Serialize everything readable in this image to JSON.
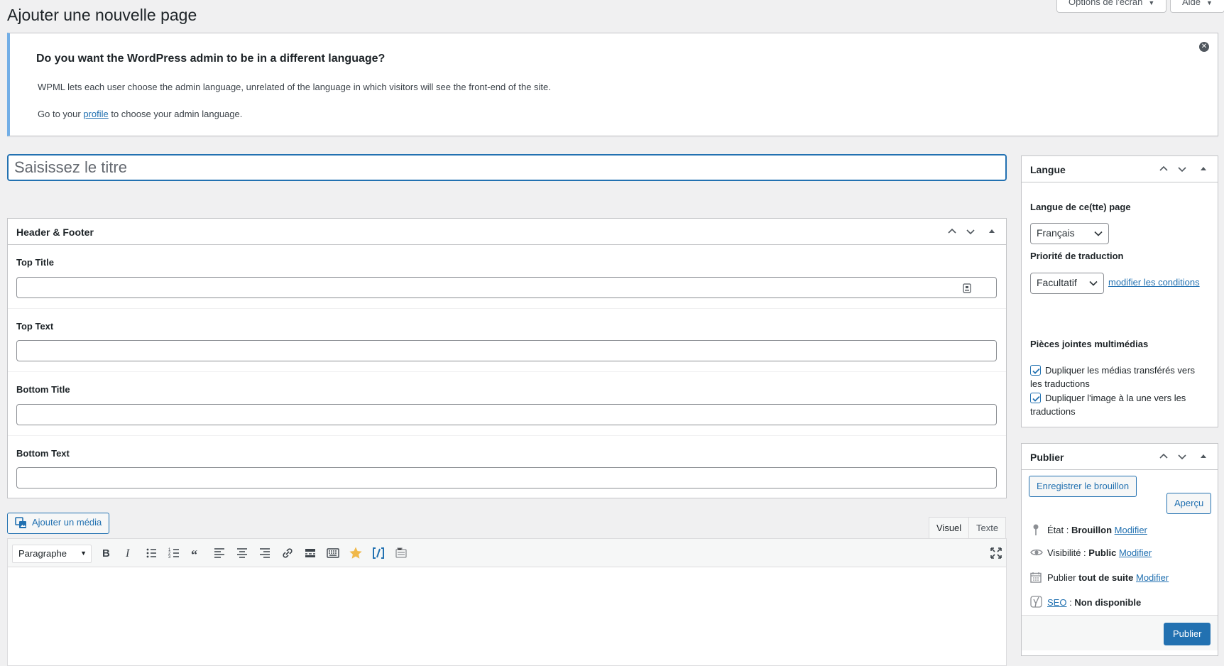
{
  "page": {
    "title": "Ajouter une nouvelle page"
  },
  "screen_options": {
    "label": "Options de l'écran"
  },
  "help": {
    "label": "Aide"
  },
  "notice": {
    "heading": "Do you want the WordPress admin to be in a different language?",
    "line1": "WPML lets each user choose the admin language, unrelated of the language in which visitors will see the front-end of the site.",
    "line2_before": "Go to your ",
    "line2_link": "profile",
    "line2_after": " to choose your admin language."
  },
  "title_input": {
    "placeholder": "Saisissez le titre",
    "value": ""
  },
  "header_footer": {
    "title": "Header & Footer",
    "fields": [
      {
        "label": "Top Title",
        "value": ""
      },
      {
        "label": "Top Text",
        "value": ""
      },
      {
        "label": "Bottom Title",
        "value": ""
      },
      {
        "label": "Bottom Text",
        "value": ""
      }
    ]
  },
  "editor": {
    "add_media": "Ajouter un média",
    "tabs": [
      "Visuel",
      "Texte"
    ],
    "active_tab": "Visuel",
    "format": "Paragraphe",
    "toolbar_icons": [
      "bold-icon",
      "italic-icon",
      "bullet-list-icon",
      "numbered-list-icon",
      "blockquote-icon",
      "align-left-icon",
      "align-center-icon",
      "align-right-icon",
      "link-icon",
      "read-more-icon",
      "toolbar-toggle-icon",
      "star-icon",
      "shortcode-icon",
      "form-icon",
      "fullscreen-icon"
    ],
    "accent_colors": {
      "star": "#f0b849",
      "shortcode": "#2271b1"
    }
  },
  "langue": {
    "title": "Langue",
    "lang_label": "Langue de ce(tte) page",
    "lang_value": "Français",
    "priority_label": "Priorité de traduction",
    "priority_value": "Facultatif",
    "priority_link": "modifier les conditions",
    "media_label": "Pièces jointes multimédias",
    "checkbox1": "Dupliquer les médias transférés vers les traductions",
    "checkbox2": "Dupliquer l'image à la une vers les traductions",
    "checkbox1_checked": true,
    "checkbox2_checked": true
  },
  "publier": {
    "title": "Publier",
    "save_draft": "Enregistrer le brouillon",
    "preview": "Aperçu",
    "status_label": "État : ",
    "status_value": "Brouillon",
    "visibility_label": "Visibilité : ",
    "visibility_value": "Public",
    "publish_label": "Publier ",
    "publish_value": "tout de suite",
    "seo_link": "SEO",
    "seo_sep": " : ",
    "seo_value": "Non disponible",
    "modify": "Modifier",
    "publish_button": "Publier"
  },
  "colors": {
    "accent": "#2271b1",
    "notice_border": "#72aee6",
    "background": "#f0f0f1"
  }
}
